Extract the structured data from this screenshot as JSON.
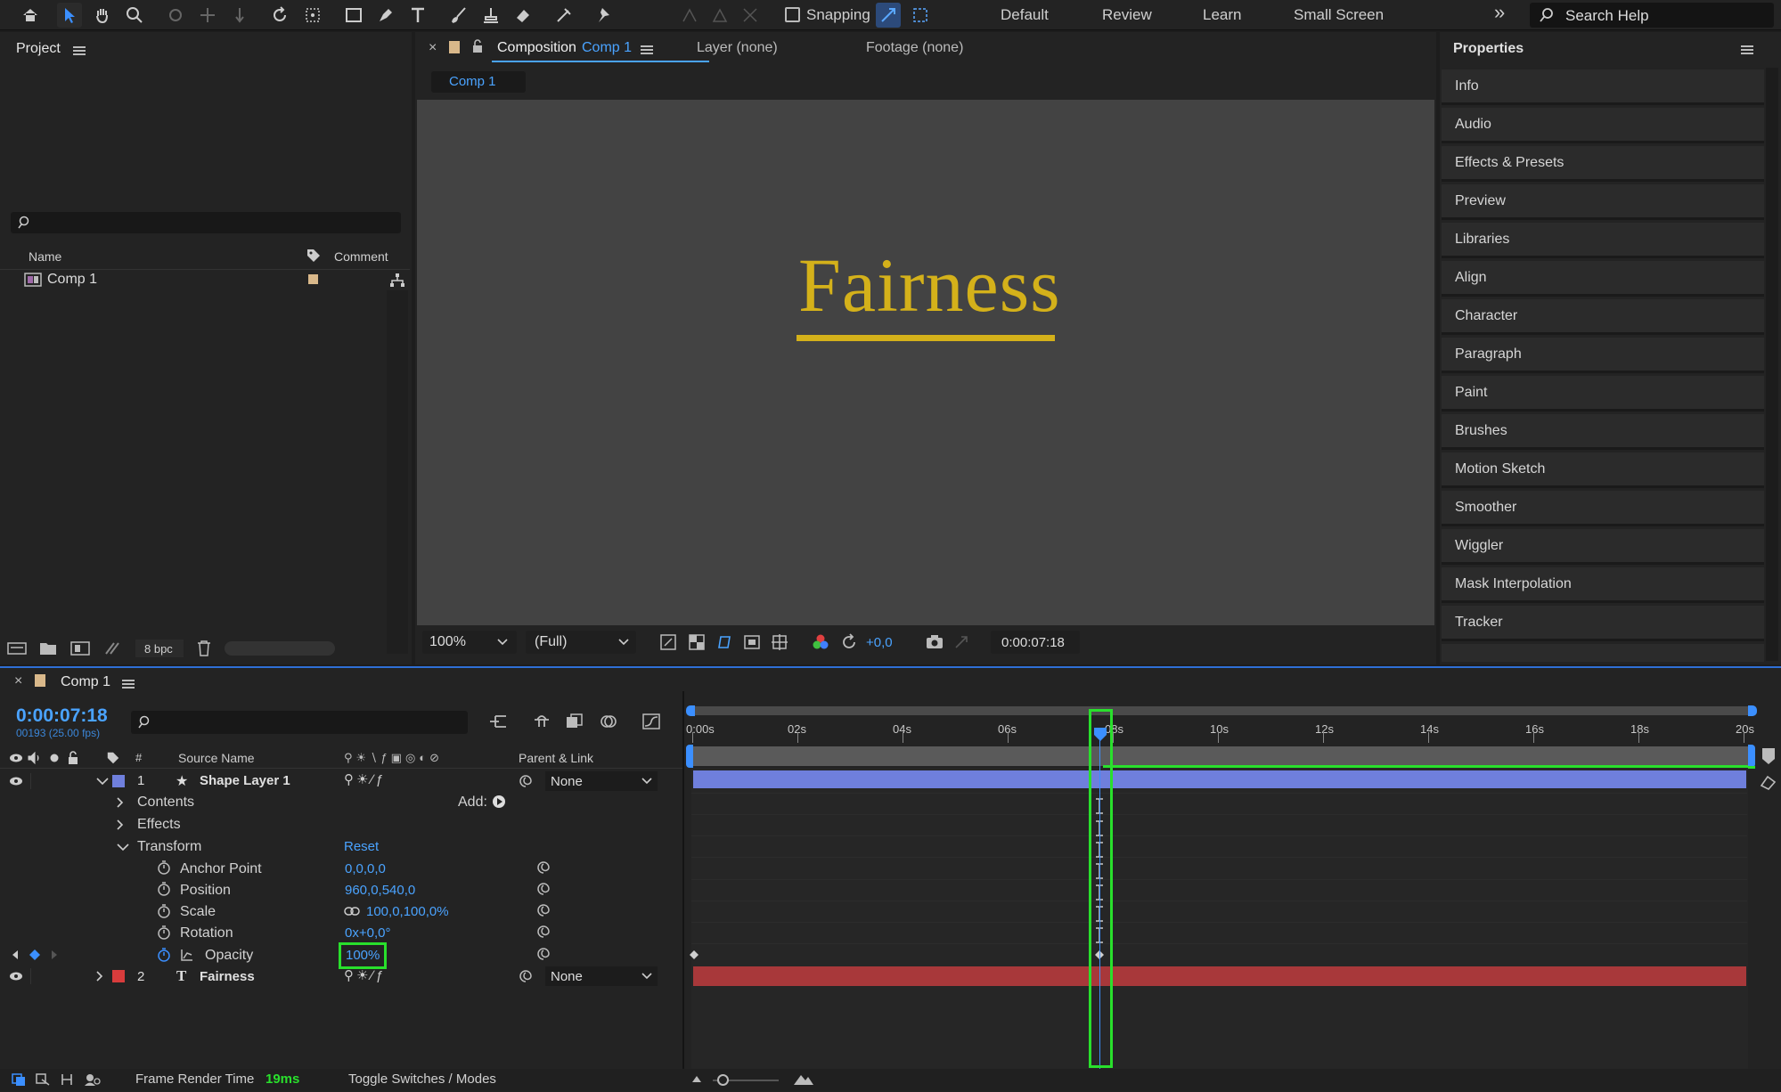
{
  "toolbar": {
    "snapping_label": "Snapping",
    "workspaces": [
      "Default",
      "Review",
      "Learn",
      "Small Screen"
    ],
    "more": "»",
    "search_placeholder": "Search Help"
  },
  "project": {
    "title": "Project",
    "col_name": "Name",
    "col_comment": "Comment",
    "item": "Comp 1",
    "bpc": "8 bpc"
  },
  "composition": {
    "close": "×",
    "tab_prefix": "Composition",
    "tab_comp": "Comp 1",
    "layer_tab": "Layer (none)",
    "footage_tab": "Footage (none)",
    "sub_tab": "Comp 1",
    "viewer_text": "Fairness",
    "zoom": "100%",
    "resolution": "(Full)",
    "exposure": "+0,0",
    "timecode": "0:00:07:18",
    "text_color": "#d4b11a"
  },
  "properties": {
    "title": "Properties",
    "items": [
      "Info",
      "Audio",
      "Effects & Presets",
      "Preview",
      "Libraries",
      "Align",
      "Character",
      "Paragraph",
      "Paint",
      "Brushes",
      "Motion Sketch",
      "Smoother",
      "Wiggler",
      "Mask Interpolation",
      "Tracker"
    ]
  },
  "timeline": {
    "close": "×",
    "comp_name": "Comp 1",
    "timecode": "0:00:07:18",
    "frame_info": "00193 (25.00 fps)",
    "col_hash": "#",
    "col_source": "Source Name",
    "col_parent": "Parent & Link",
    "layer1": {
      "num": "1",
      "name": "Shape Layer 1",
      "parent": "None",
      "color": "#6f7fdc"
    },
    "contents": "Contents",
    "add_label": "Add:",
    "effects": "Effects",
    "transform": "Transform",
    "reset": "Reset",
    "props": [
      {
        "name": "Anchor Point",
        "value": "0,0,0,0"
      },
      {
        "name": "Position",
        "value": "960,0,540,0"
      },
      {
        "name": "Scale",
        "value": "100,0,100,0%"
      },
      {
        "name": "Rotation",
        "value": "0x+0,0°"
      },
      {
        "name": "Opacity",
        "value": "100%"
      }
    ],
    "layer2": {
      "num": "2",
      "name": "Fairness",
      "parent": "None",
      "color": "#d83c3c"
    },
    "ruler": [
      "0:00s",
      "02s",
      "04s",
      "06s",
      "08s",
      "10s",
      "12s",
      "14s",
      "16s",
      "18s",
      "20s"
    ],
    "frame_render_label": "Frame Render Time",
    "frame_render_value": "19ms",
    "toggle_label": "Toggle Switches / Modes",
    "highlight_color": "#29e02c"
  }
}
